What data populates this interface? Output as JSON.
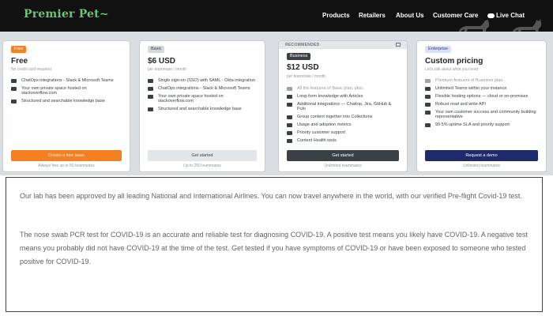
{
  "header": {
    "logo": "Premier Pet",
    "nav": [
      "Products",
      "Retailers",
      "About Us",
      "Customer Care",
      "Live Chat"
    ]
  },
  "pricing": {
    "recommended_label": "RECOMMENDED",
    "cards": [
      {
        "badge": "Free",
        "price": "Free",
        "subline": "No credit card required",
        "features": [
          "ChatOps integrations - Slack & Microsoft Teams",
          "Your own private space hosted on stackoverflow.com",
          "Structured and searchable knowledge base"
        ],
        "cta": "Create a free team",
        "footnote": "Always free up to 50 teammates"
      },
      {
        "badge": "Basic",
        "price": "$6 USD",
        "subline": "per teammate / month",
        "features": [
          "Single sign-on (SSO) with SAML - Okta integration",
          "ChatOps integrations - Slack & Microsoft Teams",
          "Your own private space hosted on stackoverflow.com",
          "Structured and searchable knowledge base"
        ],
        "cta": "Get started",
        "footnote": "Up to 250 teammates"
      },
      {
        "badge": "Business",
        "price": "$12 USD",
        "subline": "per teammate / month",
        "features": [
          "All the features of Basic plan, plus:",
          "Long-form knowledge with Articles",
          "Additional integrations — Chattop, Jira, GitHub & Pulo",
          "Group content together into Collections",
          "Usage and adoption metrics",
          "Priority customer support",
          "Content Health tools"
        ],
        "cta": "Get started",
        "footnote": "Unlimited teammates"
      },
      {
        "badge": "Enterprise",
        "price": "Custom pricing",
        "subline": "Let's talk about what you need",
        "features": [
          "Premium features of Business plan...",
          "Unlimited Teams within your instance",
          "Flexible hosting options — cloud or on-premises",
          "Robust read and write API",
          "Your own customer success and community building representative",
          "99.5% uptime SLA and priority support"
        ],
        "cta": "Request a demo",
        "footnote": "Unlimited teammates"
      }
    ]
  },
  "text_panel": {
    "paragraph1": "Our lab has been approved by all leading National and International Airlines. You can now travel anywhere in the world, with our verified Pre-flight Covid-19 test.",
    "paragraph2": "The nose swab PCR test for COVID-19 is an accurate and reliable test for diagnosing COVID-19. A positive test means you likely have COVID-19. A negative test means you probably did not have COVID-19 at the time of the test. Get tested if you have symptoms of COVID-19 or have been exposed to someone who tested positive for COVID-19."
  },
  "colors": {
    "header_bg": "#111111",
    "logo_green": "#6ec27a",
    "free_orange": "#f48024",
    "business_dark": "#3b4045",
    "enterprise_navy": "#1f2a6b"
  }
}
